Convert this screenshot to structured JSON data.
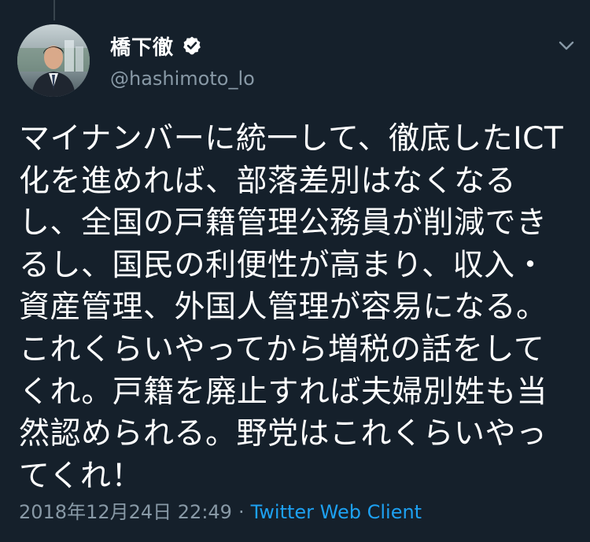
{
  "tweet": {
    "author": {
      "display_name": "橋下徹",
      "handle": "@hashimoto_lo",
      "verified": true
    },
    "text": "マイナンバーに統一して、徹底したICT化を進めれば、部落差別はなくなるし、全国の戸籍管理公務員が削減できるし、国民の利便性が高まり、収入・資産管理、外国人管理が容易になる。これくらいやってから増税の話をしてくれ。戸籍を廃止すれば夫婦別姓も当然認められる。野党はこれくらいやってくれ！",
    "timestamp": "2018年12月24日 22:49",
    "separator": "·",
    "source": "Twitter Web Client"
  },
  "icons": {
    "verified": "verified-badge-icon",
    "menu": "chevron-down-icon"
  },
  "colors": {
    "background": "#15202b",
    "text": "#ffffff",
    "secondary": "#8899a6",
    "link": "#1da1f2"
  }
}
